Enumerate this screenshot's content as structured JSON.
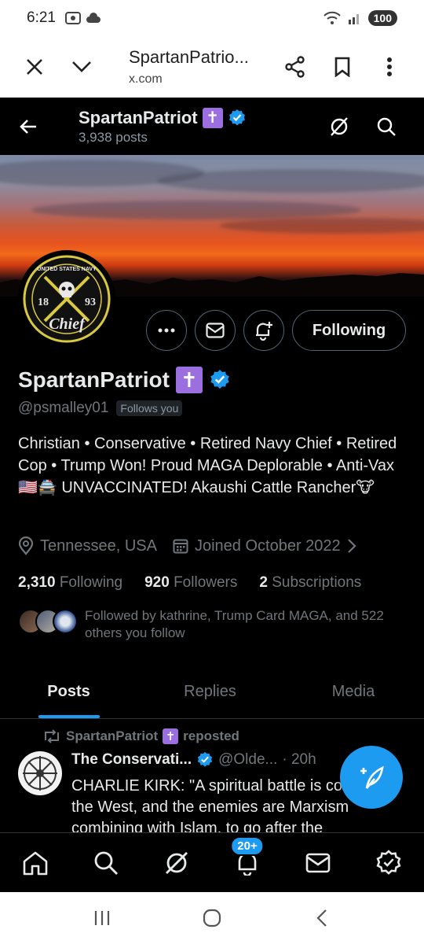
{
  "status_bar": {
    "time": "6:21",
    "battery": "100"
  },
  "browser": {
    "title": "SpartanPatrio...",
    "url": "x.com"
  },
  "header": {
    "name": "SpartanPatriot",
    "post_count": "3,938 posts",
    "badge_glyph": "✝"
  },
  "profile": {
    "name": "SpartanPatriot",
    "handle": "@psmalley01",
    "follows_you": "Follows you",
    "bio": "Christian • Conservative • Retired Navy Chief • Retired Cop • Trump Won! Proud MAGA Deplorable • Anti-Vax 🇺🇸🚔 UNVACCINATED! Akaushi Cattle Rancher🐮",
    "location": "Tennessee, USA",
    "joined": "Joined October 2022",
    "following_count": "2,310",
    "following_label": "Following",
    "followers_count": "920",
    "followers_label": "Followers",
    "subscriptions_count": "2",
    "subscriptions_label": "Subscriptions",
    "followed_by": "Followed by kathrine, Trump Card MAGA, and 522 others you follow",
    "following_button": "Following",
    "avatar_text": {
      "top": "UNITED STATES NAVY",
      "year_left": "18",
      "year_right": "93",
      "rank": "Chief"
    }
  },
  "tabs": [
    {
      "label": "Posts",
      "active": true
    },
    {
      "label": "Replies",
      "active": false
    },
    {
      "label": "Media",
      "active": false
    }
  ],
  "post": {
    "repost_by": "SpartanPatriot",
    "repost_label": "reposted",
    "author_name": "The Conservati...",
    "author_handle": "@Olde...",
    "time": "· 20h",
    "text": "CHARLIE KIRK: \"A spiritual battle is coming to the West, and the enemies are Marxism combining with Islam, to go after the"
  },
  "bottom_nav": {
    "notifications_badge": "20+"
  },
  "colors": {
    "accent": "#1d9bf0",
    "badge_purple": "#9b6fe0",
    "muted": "#71767b"
  }
}
